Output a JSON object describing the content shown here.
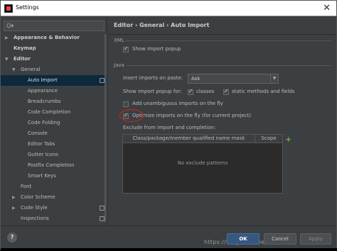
{
  "window": {
    "title": "Settings"
  },
  "search": {
    "placeholder": "Q▾"
  },
  "tree": [
    {
      "label": "Appearance & Behavior",
      "expanded": false,
      "bold": true
    },
    {
      "label": "Keymap",
      "bold": true
    },
    {
      "label": "Editor",
      "expanded": true,
      "bold": true
    },
    {
      "label": "General",
      "expanded": true
    },
    {
      "label": "Auto Import",
      "selected": true
    },
    {
      "label": "Appearance"
    },
    {
      "label": "Breadcrumbs"
    },
    {
      "label": "Code Completion"
    },
    {
      "label": "Code Folding"
    },
    {
      "label": "Console"
    },
    {
      "label": "Editor Tabs"
    },
    {
      "label": "Gutter Icons"
    },
    {
      "label": "Postfix Completion"
    },
    {
      "label": "Smart Keys"
    },
    {
      "label": "Font"
    },
    {
      "label": "Color Scheme",
      "expanded": false
    },
    {
      "label": "Code Style",
      "expanded": false
    },
    {
      "label": "Inspections"
    }
  ],
  "breadcrumb": "Editor  ›  General  ›  Auto Import",
  "xml": {
    "section": "XML",
    "show_import_popup": {
      "label": "Show import popup",
      "checked": true
    }
  },
  "java": {
    "section": "Java",
    "insert_imports_label": "Insert imports on paste:",
    "insert_imports_value": "Ask",
    "show_popup_for_label": "Show import popup for:",
    "classes": {
      "label": "classes",
      "checked": true
    },
    "static_methods": {
      "label": "static methods and fields",
      "checked": true
    },
    "add_unambiguous": {
      "label": "Add unambiguous imports on the fly",
      "checked": false
    },
    "optimize_imports": {
      "label": "Optimize imports on the fly (for current project)",
      "checked": true
    },
    "exclude_label": "Exclude from import and completion:",
    "table": {
      "col_pattern": "Class/package/member qualified name mask",
      "col_scope": "Scope",
      "empty_text": "No exclude patterns"
    }
  },
  "footer": {
    "help": "?",
    "ok": "OK",
    "cancel": "Cancel",
    "apply": "Apply",
    "watermark": "https://blog.csdn.net/hustzx07"
  },
  "colors": {
    "selected": "#0d293e",
    "accent_ok": "#365880",
    "highlight_circle": "#d62020",
    "add": "#5fb832"
  }
}
